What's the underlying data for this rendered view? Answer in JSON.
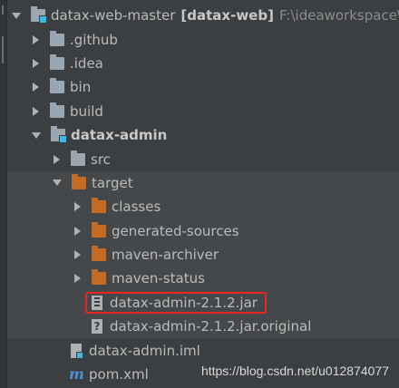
{
  "project_tree": {
    "root": {
      "name": "datax-web-master",
      "module": "[datax-web]",
      "path": "F:\\ideaworkspace\\d"
    },
    "items": [
      {
        "label": ".github",
        "type": "folder"
      },
      {
        "label": ".idea",
        "type": "folder"
      },
      {
        "label": "bin",
        "type": "folder"
      },
      {
        "label": "build",
        "type": "folder"
      },
      {
        "label": "datax-admin",
        "type": "module"
      },
      {
        "label": "src",
        "type": "folder"
      },
      {
        "label": "target",
        "type": "folder-excluded"
      },
      {
        "label": "classes",
        "type": "folder-excluded"
      },
      {
        "label": "generated-sources",
        "type": "folder-excluded"
      },
      {
        "label": "maven-archiver",
        "type": "folder-excluded"
      },
      {
        "label": "maven-status",
        "type": "folder-excluded"
      },
      {
        "label": "datax-admin-2.1.2.jar",
        "type": "jar"
      },
      {
        "label": "datax-admin-2.1.2.jar.original",
        "type": "unknown-file"
      },
      {
        "label": "datax-admin.iml",
        "type": "iml"
      },
      {
        "label": "pom.xml",
        "type": "maven"
      }
    ]
  },
  "watermark": "https://blog.csdn.net/u012874077",
  "colors": {
    "background": "#3c3f41",
    "highlight_border": "#e8261e",
    "folder_gray": "#9aa7b0",
    "folder_orange": "#c46b26",
    "module_accent": "#40b6e0"
  }
}
